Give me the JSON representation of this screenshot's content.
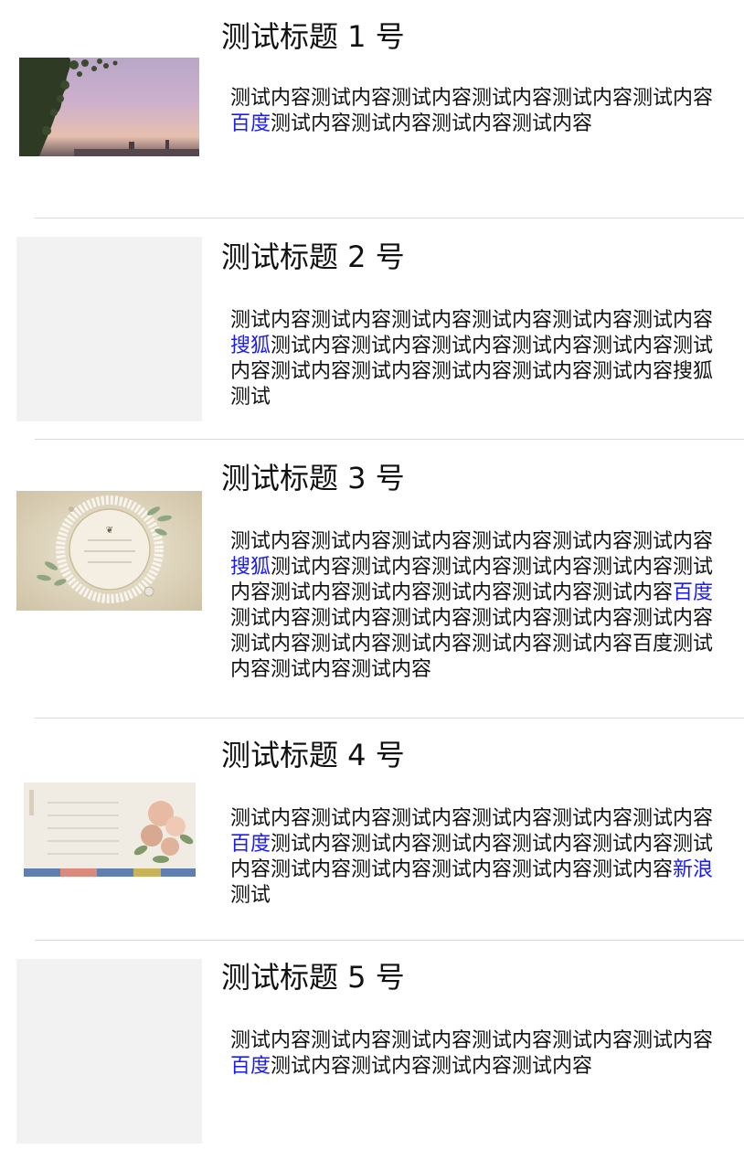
{
  "items": [
    {
      "title": "测试标题 1 号",
      "image_desc": "sunset-branches",
      "content": [
        {
          "t": "测试内容测试内容测试内容测试内容测试内容测试内容"
        },
        {
          "t": "百度",
          "link": true
        },
        {
          "t": "测试内容测试内容测试内容测试内容"
        }
      ]
    },
    {
      "title": "测试标题 2 号",
      "image_desc": "placeholder",
      "content": [
        {
          "t": "测试内容测试内容测试内容测试内容测试内容测试内容"
        },
        {
          "t": "搜狐",
          "link": true
        },
        {
          "t": "测试内容测试内容测试内容测试内容测试内容测试内容测试内容测试内容测试内容测试内容测试内容搜狐测试"
        }
      ]
    },
    {
      "title": "测试标题 3 号",
      "image_desc": "vintage-lace-frame",
      "content": [
        {
          "t": "测试内容测试内容测试内容测试内容测试内容测试内容"
        },
        {
          "t": "搜狐",
          "link": true
        },
        {
          "t": "测试内容测试内容测试内容测试内容测试内容测试内容测试内容测试内容测试内容测试内容测试内容"
        },
        {
          "t": "百度",
          "link": true
        },
        {
          "t": "测试内容测试内容测试内容测试内容测试内容测试内容测试内容测试内容测试内容测试内容测试内容百度测试内容测试内容测试内容"
        }
      ]
    },
    {
      "title": "测试标题 4 号",
      "image_desc": "floral-postcard",
      "content": [
        {
          "t": "测试内容测试内容测试内容测试内容测试内容测试内容"
        },
        {
          "t": "百度",
          "link": true
        },
        {
          "t": "测试内容测试内容测试内容测试内容测试内容测试内容测试内容测试内容测试内容测试内容测试内容"
        },
        {
          "t": "新浪",
          "link": true
        },
        {
          "t": "测试"
        }
      ]
    },
    {
      "title": "测试标题 5 号",
      "image_desc": "placeholder",
      "content": [
        {
          "t": "测试内容测试内容测试内容测试内容测试内容测试内容"
        },
        {
          "t": "百度",
          "link": true
        },
        {
          "t": "测试内容测试内容测试内容测试内容"
        }
      ]
    }
  ],
  "colors": {
    "link": "#1a1aff",
    "separator": "#d9d9d9",
    "placeholder": "#f2f2f2"
  }
}
